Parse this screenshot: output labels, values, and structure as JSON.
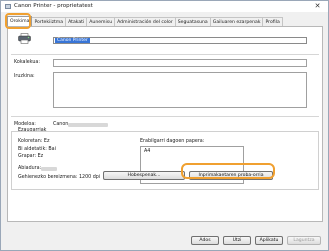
{
  "window": {
    "title": "Canon Printer - proprietatest",
    "close_glyph": "✕"
  },
  "tabs": [
    {
      "label": "Orokima"
    },
    {
      "label": "Portekiiztma"
    },
    {
      "label": "Atakati"
    },
    {
      "label": "Aunemisu"
    },
    {
      "label": "Administración del color"
    },
    {
      "label": "Seguatasuna"
    },
    {
      "label": "Gailuaren ezarpenak"
    },
    {
      "label": "Profila"
    }
  ],
  "general": {
    "printer_name": "Canon Printer",
    "location_label": "Kokalekua:",
    "comment_label": "Iruzkina:",
    "model_label": "Modeloa:",
    "model_value": "Canon",
    "features_label": "Ezaugarriak",
    "color_label": "Koloretan: Ez",
    "duplex_label": "Bi aldetatik: Bai",
    "staple_label": "Grapar: Ez",
    "speed_label": "Abiadura:",
    "resolution_label": "Gehienezko bereizmena: 1200 dpi",
    "paper_label": "Erabilgarri dagoen papera:",
    "paper_items": [
      "A4"
    ]
  },
  "buttons": {
    "preferences": "Hobespenak...",
    "print_test": "Inprimakaetaren proba-orria",
    "ok": "Ados",
    "cancel": "Utzi",
    "apply": "Aplikatu",
    "help": "Laguntza"
  },
  "colors": {
    "accent": "#f0a030",
    "selection": "#3875d7"
  },
  "icons": [
    "printer-icon",
    "close-icon",
    "app-icon"
  ]
}
